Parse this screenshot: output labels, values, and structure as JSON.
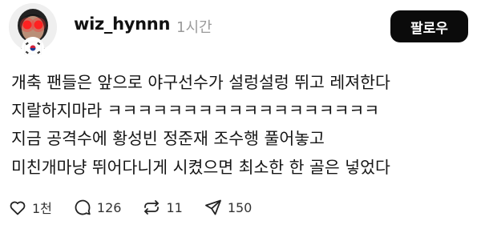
{
  "post": {
    "username": "wiz_hynnn",
    "time": "1시간",
    "follow_label": "팔로우",
    "lines": [
      "개축 팬들은 앞으로 야구선수가 설렁설렁 뛰고 레져한다",
      "지랄하지마라 ㅋㅋㅋㅋㅋㅋㅋㅋㅋㅋㅋㅋㅋㅋㅋㅋㅋㅋ",
      "지금 공격수에 황성빈 정준재 조수행 풀어놓고",
      "미친개마냥 뛰어다니게 시켰으면 최소한 한 골은 넣었다"
    ],
    "actions": {
      "likes": "1천",
      "comments": "126",
      "reposts": "11",
      "shares": "150"
    }
  },
  "icons": {
    "like": "heart-icon",
    "comment": "comment-bubble-icon",
    "repost": "repost-icon",
    "share": "send-icon",
    "badge": "korean-flag-icon"
  }
}
